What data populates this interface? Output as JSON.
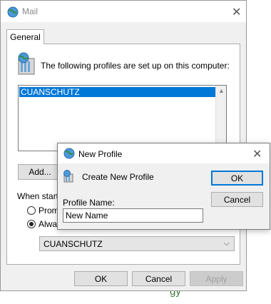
{
  "mail_window": {
    "title": "Mail",
    "tab_general": "General",
    "profiles_heading": "The following profiles are set up on this computer:",
    "profiles": [
      "CUANSCHUTZ"
    ],
    "add_button": "Add...",
    "startup_label": "When start",
    "radio_prompt": "Promp",
    "radio_always": "Alway",
    "default_profile_value": "CUANSCHUTZ",
    "ok_button": "OK",
    "cancel_button": "Cancel",
    "apply_button": "Apply"
  },
  "new_profile_dialog": {
    "title": "New Profile",
    "heading": "Create New Profile",
    "profile_name_label": "Profile Name:",
    "profile_name_value": "New Name",
    "ok_button": "OK",
    "cancel_button": "Cancel"
  },
  "background_text": "gy",
  "colors": {
    "selection": "#0078d7",
    "window_bg": "#f0f0f0",
    "focus_border": "#0078d7"
  }
}
